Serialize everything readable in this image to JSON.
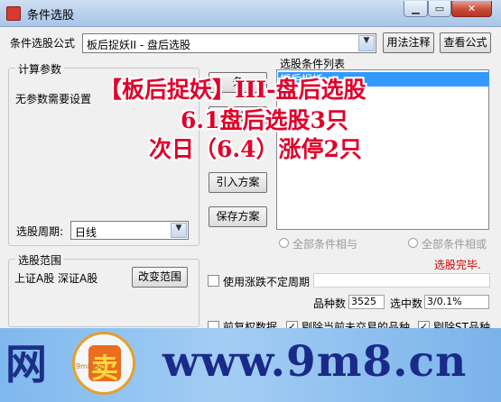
{
  "window": {
    "title": "条件选股"
  },
  "formula": {
    "label": "条件选股公式",
    "selected": "板后捉妖II  - 盘后选股",
    "usage_button": "用法注释",
    "view_button": "查看公式"
  },
  "params": {
    "legend": "计算参数",
    "empty_note": "无参数需要设置",
    "period_label": "选股周期:",
    "period_value": "日线"
  },
  "range": {
    "legend": "选股范围",
    "markets": "上证A股  深证A股",
    "change_button": "改变范围"
  },
  "conditions": {
    "list_title": "选股条件列表",
    "list_item": "板后捉妖",
    "add_button_frag": "条",
    "delete_button_frag": "删",
    "import_button": "引入方案",
    "save_button": "保存方案",
    "radio_and": "全部条件相与",
    "radio_or": "全部条件相或",
    "status": "选股完毕."
  },
  "options": {
    "uncertain_period": "使用涨跌不定周期",
    "species_label": "品种数",
    "species_value": "3525",
    "selected_label": "选中数",
    "selected_value": "3/0.1%",
    "pre_adjust": "前复权数据",
    "exclude_untraded": "剔除当前未交易的品种",
    "exclude_st": "剔除ST品种"
  },
  "overlay": {
    "line1": "【板后捉妖】III-盘后选股",
    "line2": "6.1盘后选股3只",
    "line3": "次日（6.4）涨停2只"
  },
  "watermark": {
    "char": "网",
    "logo_char": "卖",
    "url": "www.9m8.cn",
    "logo_small": "9m8.cn"
  },
  "colors": {
    "overlay_red": "#e0002a",
    "status_red": "#d00000",
    "banner_blue": "#8fc2f1",
    "url_blue": "#1a2a88"
  }
}
